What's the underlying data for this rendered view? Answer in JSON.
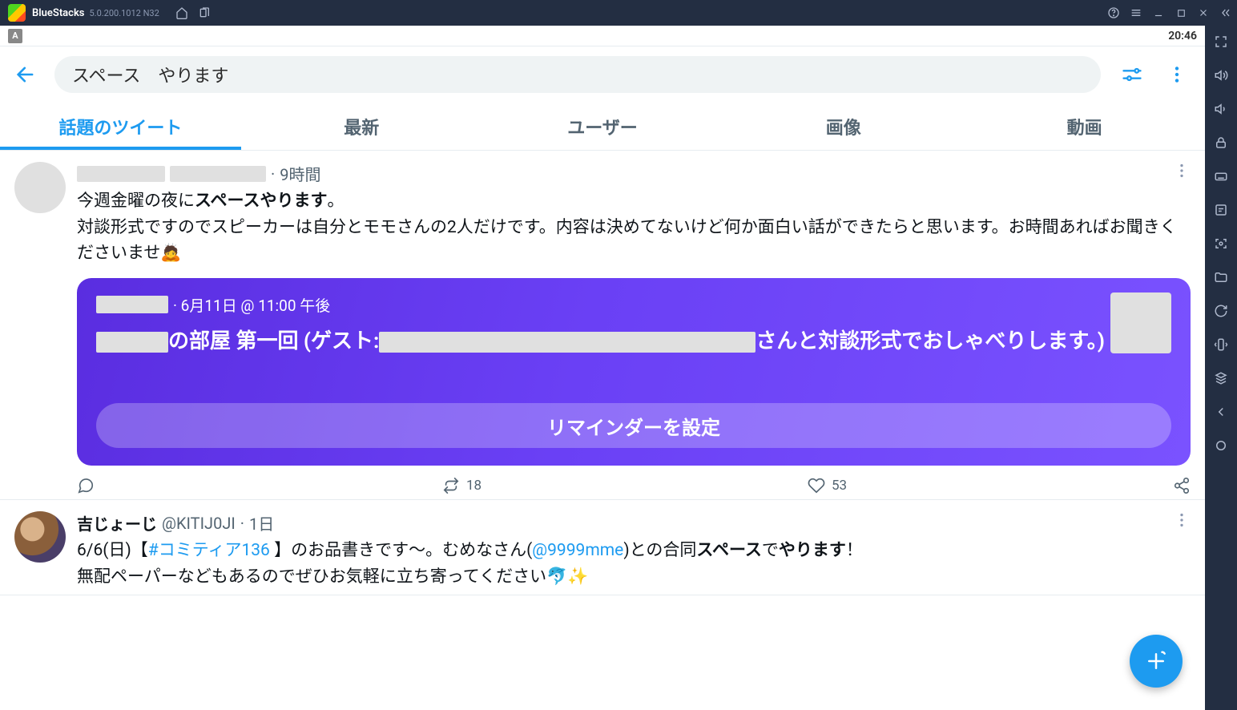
{
  "bluestacks": {
    "title": "BlueStacks",
    "version": "5.0.200.1012  N32"
  },
  "android_status": {
    "time": "20:46",
    "badge": "A"
  },
  "search": {
    "query": "スペース　やります"
  },
  "tabs": [
    {
      "label": "話題のツイート",
      "active": true
    },
    {
      "label": "最新",
      "active": false
    },
    {
      "label": "ユーザー",
      "active": false
    },
    {
      "label": "画像",
      "active": false
    },
    {
      "label": "動画",
      "active": false
    }
  ],
  "tweets": [
    {
      "time_sep": "·",
      "time": "9時間",
      "body_pre": "今週金曜の夜に",
      "body_bold": "スペースやります",
      "body_post": "。\n対談形式ですのでスピーカーは自分とモモさんの2人だけです。内容は決めてないけど何か面白い話ができたらと思います。お時間あればお聞きくださいませ🙇",
      "space": {
        "date": "· 6月11日 @ 11:00 午後",
        "title_mid1": "の部屋 第一回 (ゲスト:",
        "title_mid2": "さんと対談形式でおしゃべりします。)",
        "button": "リマインダーを設定"
      },
      "actions": {
        "retweets": "18",
        "likes": "53"
      }
    },
    {
      "name": "吉じょーじ",
      "handle": "@KITIJ0JI",
      "sep": " · ",
      "time": "1日",
      "line1_a": "6/6(日)【",
      "line1_hashtag": "#コミティア136",
      "line1_b": " 】のお品書きです〜。むめなさん(",
      "line1_mention": "@9999mme",
      "line1_c": ")との合同",
      "line1_bold1": "スペース",
      "line1_d": "で",
      "line1_bold2": "やります",
      "line1_e": "！",
      "line2": "無配ペーパーなどもあるのでぜひお気軽に立ち寄ってください🐬✨"
    }
  ]
}
